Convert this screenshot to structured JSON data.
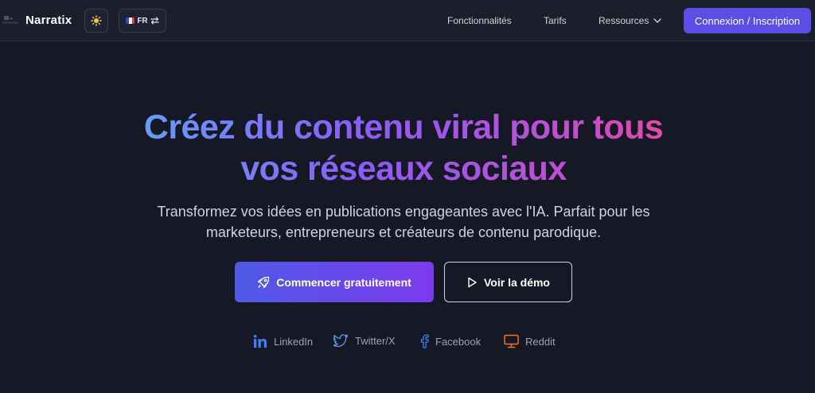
{
  "header": {
    "brand": "Narratix",
    "language": {
      "code": "FR",
      "flag_colors": [
        "#2b4fb0",
        "#ffffff",
        "#e2364b"
      ]
    },
    "nav": [
      {
        "label": "Fonctionnalités"
      },
      {
        "label": "Tarifs"
      },
      {
        "label": "Ressources"
      }
    ],
    "cta_label": "Connexion / Inscription"
  },
  "hero": {
    "title_line1": "Créez du contenu viral pour tous",
    "title_line2": "vos réseaux sociaux",
    "subtitle_line1": "Transformez vos idées en publications engageantes avec l'IA. Parfait pour les",
    "subtitle_line2": "marketeurs, entrepreneurs et créateurs de contenu parodique.",
    "primary_button": "Commencer gratuitement",
    "secondary_button": "Voir la démo"
  },
  "platforms": [
    {
      "label": "LinkedIn",
      "icon": "linkedin-icon",
      "color": "#3b82f6"
    },
    {
      "label": "Twitter/X",
      "icon": "twitter-icon",
      "color": "#60a5fa"
    },
    {
      "label": "Facebook",
      "icon": "facebook-icon",
      "color": "#3b82f6"
    },
    {
      "label": "Reddit",
      "icon": "reddit-icon",
      "color": "#f97316"
    }
  ],
  "colors": {
    "background": "#161925",
    "accent": "#5b4ee6",
    "gradient_start": "#60a5fa",
    "gradient_end": "#ec4899"
  }
}
